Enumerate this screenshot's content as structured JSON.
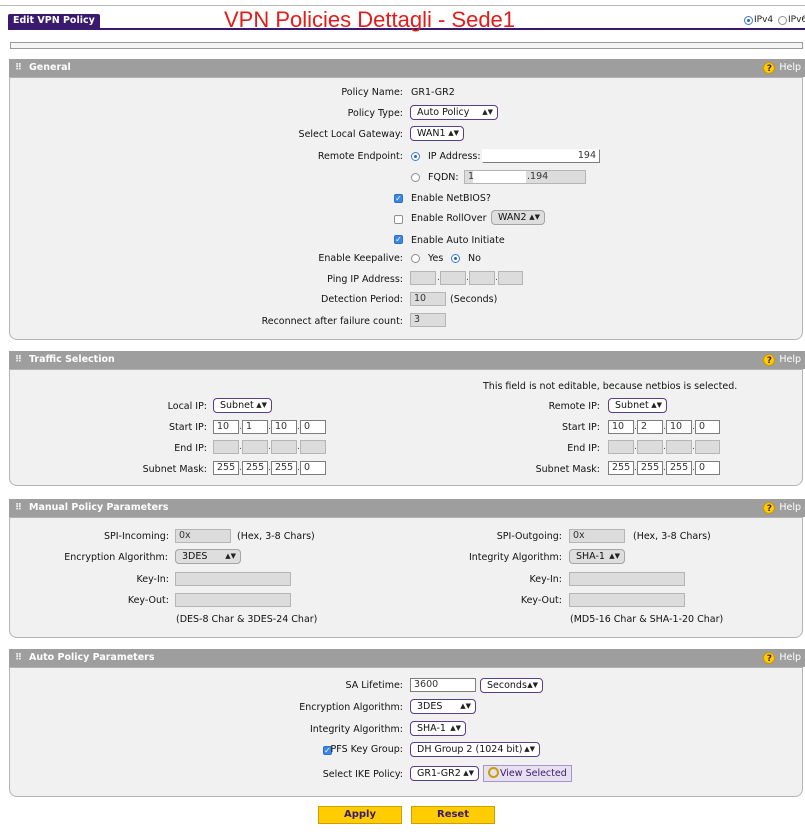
{
  "header": {
    "tab_label": "Edit VPN Policy",
    "red_title": "VPN Policies Dettagli - Sede1",
    "ipv4_label": "IPv4",
    "ipv6_label": "IPv6",
    "ip_mode_selected": "IPv4"
  },
  "help_label": "Help",
  "general": {
    "title": "General",
    "policy_name_label": "Policy Name:",
    "policy_name_value": "GR1-GR2",
    "policy_type_label": "Policy Type:",
    "policy_type_value": "Auto Policy",
    "local_gateway_label": "Select Local Gateway:",
    "local_gateway_value": "WAN1",
    "remote_endpoint_label": "Remote Endpoint:",
    "ip_address_label": "IP Address:",
    "ip_address_value": "194",
    "fqdn_label": "FQDN:",
    "fqdn_value_left": "1",
    "fqdn_value_right": ".194",
    "remote_endpoint_selected": "IP Address",
    "enable_netbios_label": "Enable NetBIOS?",
    "enable_netbios_checked": true,
    "enable_rollover_label": "Enable RollOver",
    "enable_rollover_checked": false,
    "rollover_wan_value": "WAN2",
    "enable_auto_initiate_label": "Enable Auto Initiate",
    "enable_auto_initiate_checked": true,
    "enable_keepalive_label": "Enable Keepalive:",
    "keepalive_yes": "Yes",
    "keepalive_no": "No",
    "keepalive_selected": "No",
    "ping_ip_label": "Ping IP Address:",
    "detection_period_label": "Detection Period:",
    "detection_period_value": "10",
    "detection_period_unit": "(Seconds)",
    "reconnect_label": "Reconnect after failure count:",
    "reconnect_value": "3"
  },
  "traffic": {
    "title": "Traffic Selection",
    "note": "This field is not editable, because netbios is selected.",
    "local_ip_label": "Local IP:",
    "local_ip_type": "Subnet",
    "local_start_label": "Start IP:",
    "local_start": [
      "10",
      "1",
      "10",
      "0"
    ],
    "local_end_label": "End IP:",
    "local_mask_label": "Subnet Mask:",
    "local_mask": [
      "255",
      "255",
      "255",
      "0"
    ],
    "remote_ip_label": "Remote IP:",
    "remote_ip_type": "Subnet",
    "remote_start_label": "Start IP:",
    "remote_start": [
      "10",
      "2",
      "10",
      "0"
    ],
    "remote_end_label": "End IP:",
    "remote_mask_label": "Subnet Mask:",
    "remote_mask": [
      "255",
      "255",
      "255",
      "0"
    ]
  },
  "manual": {
    "title": "Manual Policy Parameters",
    "spi_in_label": "SPI-Incoming:",
    "spi_in_value": "0x",
    "spi_in_hint": "(Hex, 3-8 Chars)",
    "spi_out_label": "SPI-Outgoing:",
    "spi_out_value": "0x",
    "spi_out_hint": "(Hex, 3-8 Chars)",
    "enc_label": "Encryption Algorithm:",
    "enc_value": "3DES",
    "int_label": "Integrity Algorithm:",
    "int_value": "SHA-1",
    "key_in_label": "Key-In:",
    "key_out_label": "Key-Out:",
    "key_in_label_r": "Key-In:",
    "key_out_label_r": "Key-Out:",
    "enc_hint": "(DES-8 Char & 3DES-24 Char)",
    "int_hint": "(MD5-16 Char & SHA-1-20 Char)"
  },
  "auto": {
    "title": "Auto Policy Parameters",
    "sa_lifetime_label": "SA Lifetime:",
    "sa_lifetime_value": "3600",
    "sa_lifetime_unit": "Seconds",
    "enc_label": "Encryption Algorithm:",
    "enc_value": "3DES",
    "int_label": "Integrity Algorithm:",
    "int_value": "SHA-1",
    "pfs_label": "PFS Key Group:",
    "pfs_checked": true,
    "pfs_value": "DH Group 2 (1024 bit)",
    "ike_label": "Select IKE Policy:",
    "ike_value": "GR1-GR2",
    "view_selected_label": "View Selected"
  },
  "actions": {
    "apply_label": "Apply",
    "reset_label": "Reset"
  },
  "colors": {
    "brand_purple": "#3a1a6e",
    "title_red": "#e41b17",
    "section_header": "#9e9e9e",
    "button_yellow": "#ffcc00"
  }
}
